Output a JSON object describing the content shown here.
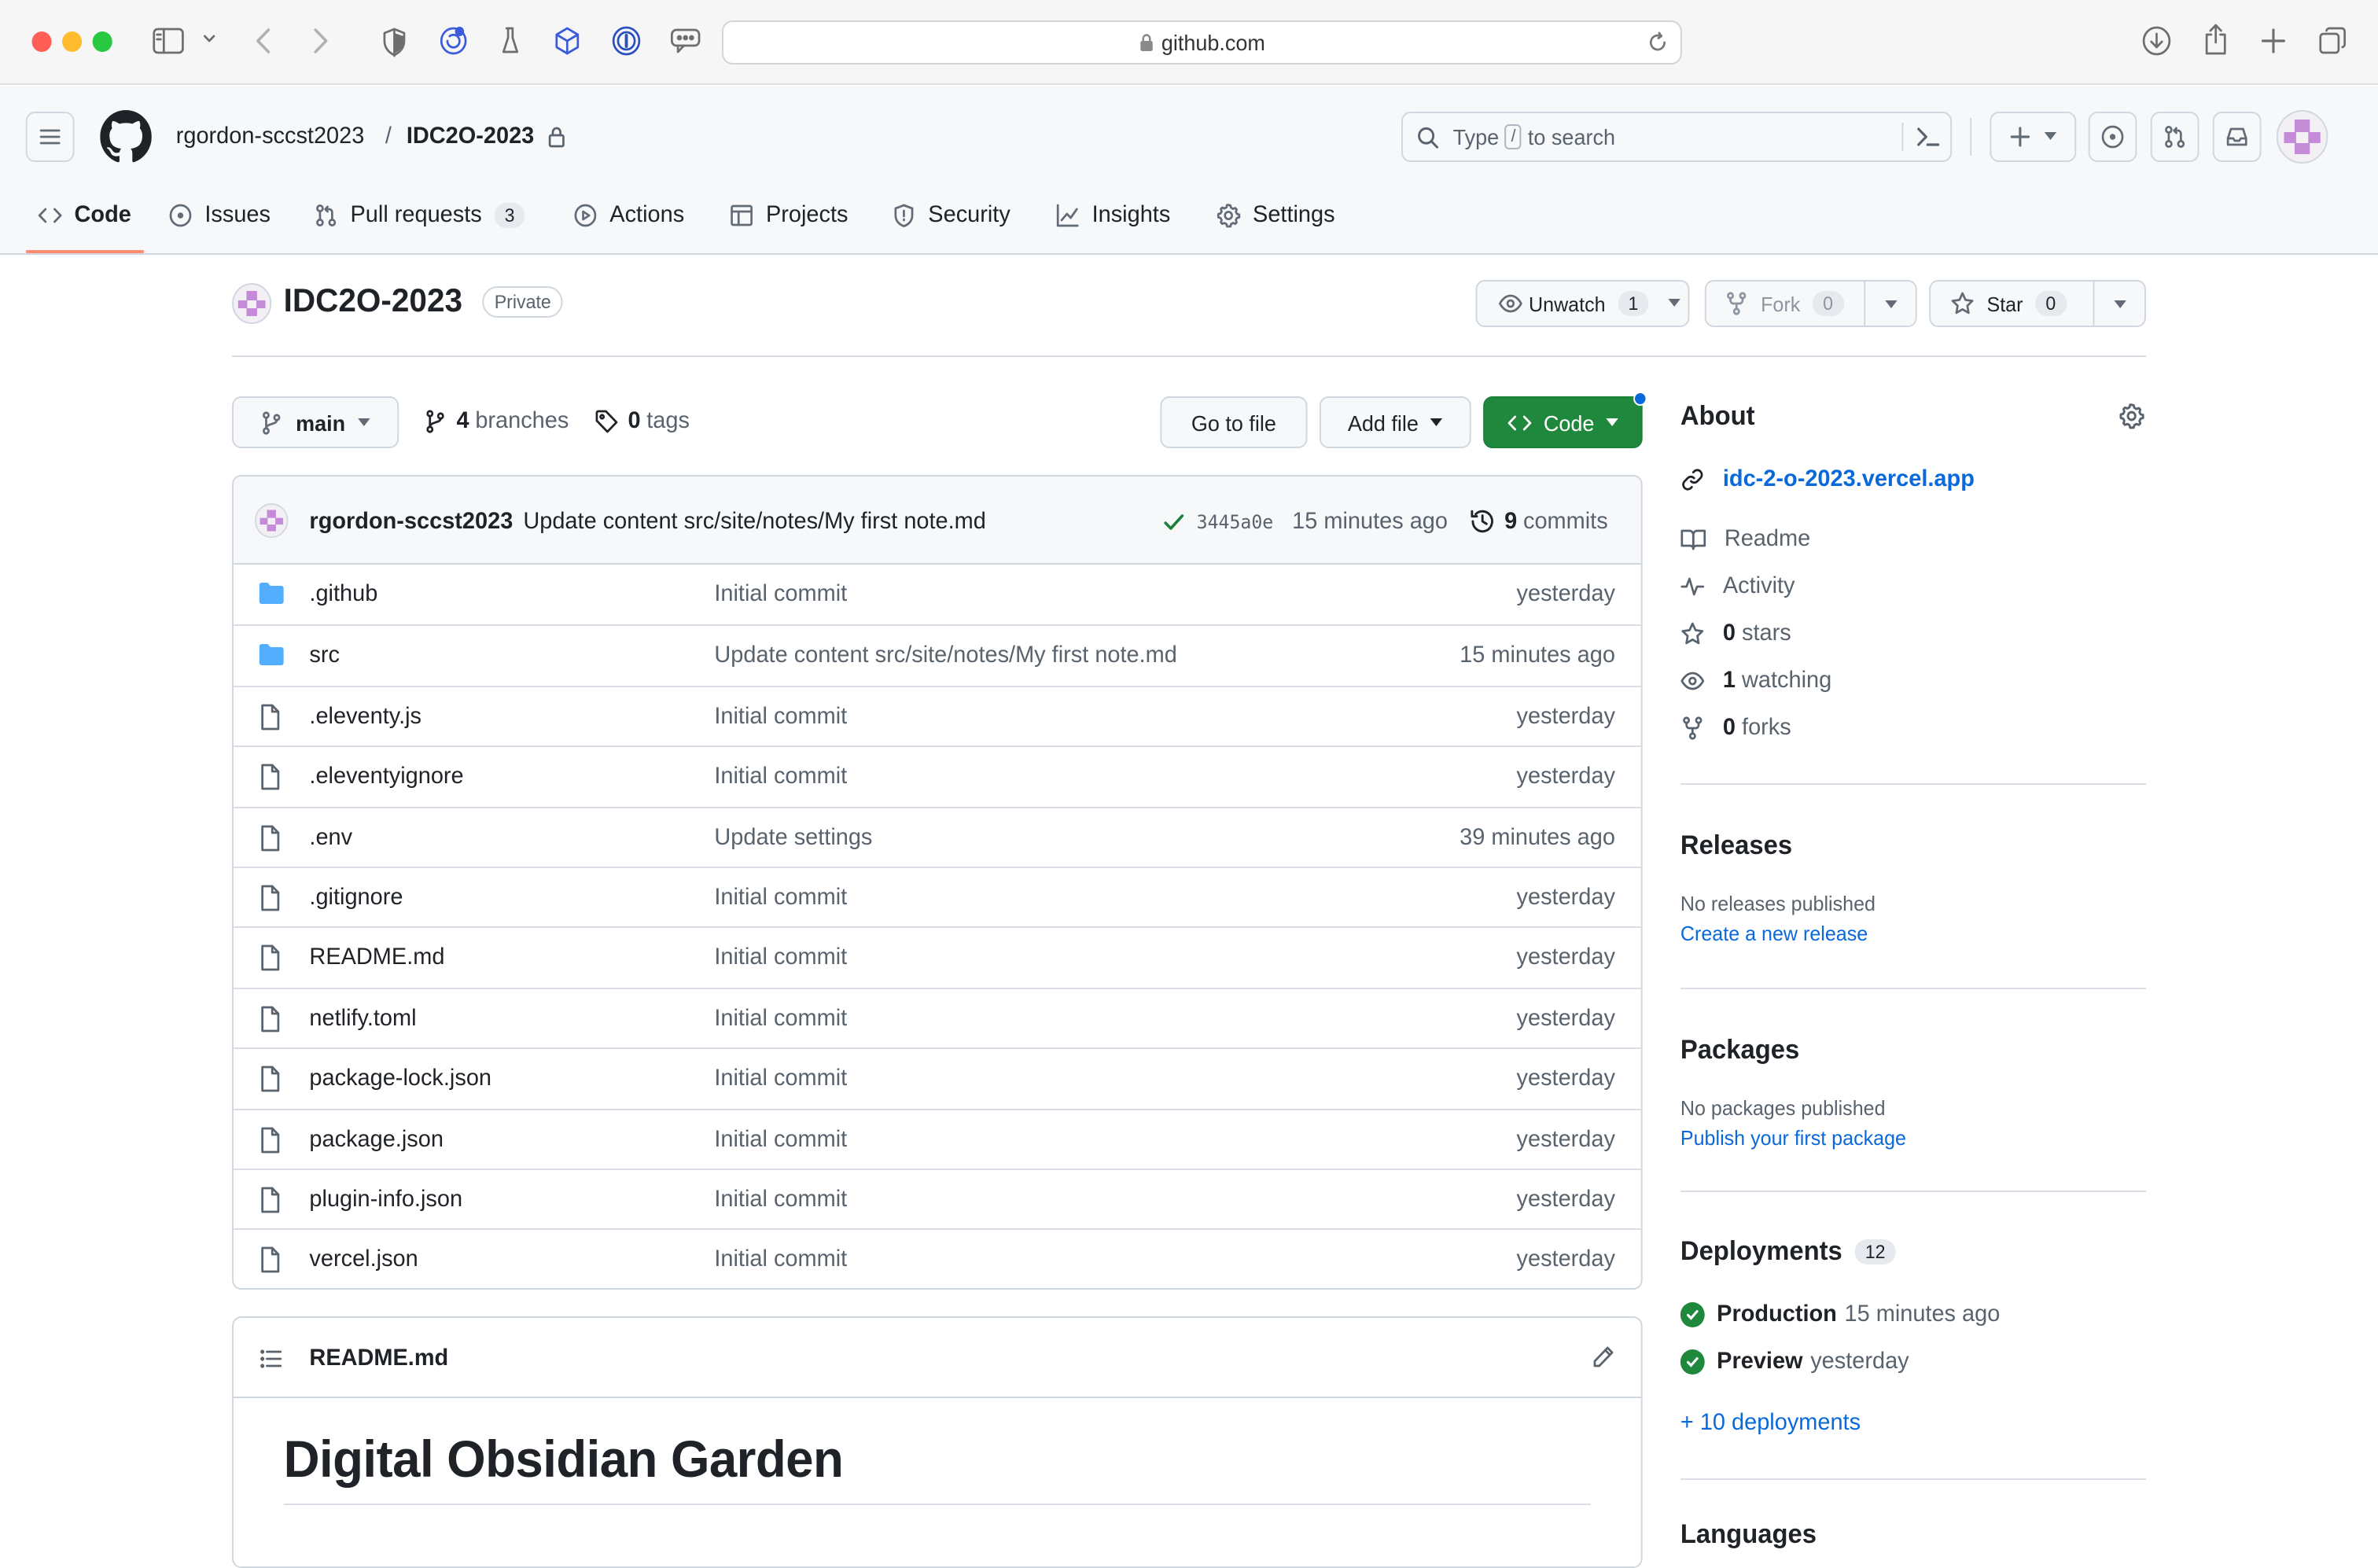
{
  "browser": {
    "url": "github.com"
  },
  "header": {
    "owner": "rgordon-sccst2023",
    "separator": "/",
    "repo": "IDC2O-2023",
    "search_prefix": "Type",
    "search_key": "/",
    "search_suffix": "to search"
  },
  "tabs": [
    {
      "label": "Code"
    },
    {
      "label": "Issues"
    },
    {
      "label": "Pull requests",
      "count": "3"
    },
    {
      "label": "Actions"
    },
    {
      "label": "Projects"
    },
    {
      "label": "Security"
    },
    {
      "label": "Insights"
    },
    {
      "label": "Settings"
    }
  ],
  "repo": {
    "name": "IDC2O-2023",
    "visibility": "Private",
    "unwatch_label": "Unwatch",
    "watch_count": "1",
    "fork_label": "Fork",
    "fork_count": "0",
    "star_label": "Star",
    "star_count": "0"
  },
  "toolbar": {
    "branch": "main",
    "branches_count": "4",
    "branches_label": "branches",
    "tags_count": "0",
    "tags_label": "tags",
    "go_to_file": "Go to file",
    "add_file": "Add file",
    "code": "Code"
  },
  "commit": {
    "author": "rgordon-sccst2023",
    "message": "Update content src/site/notes/My first note.md",
    "sha": "3445a0e",
    "age": "15 minutes ago",
    "commits_count": "9",
    "commits_label": "commits"
  },
  "files": [
    {
      "type": "folder",
      "name": ".github",
      "message": "Initial commit",
      "age": "yesterday"
    },
    {
      "type": "folder",
      "name": "src",
      "message": "Update content src/site/notes/My first note.md",
      "age": "15 minutes ago"
    },
    {
      "type": "file",
      "name": ".eleventy.js",
      "message": "Initial commit",
      "age": "yesterday"
    },
    {
      "type": "file",
      "name": ".eleventyignore",
      "message": "Initial commit",
      "age": "yesterday"
    },
    {
      "type": "file",
      "name": ".env",
      "message": "Update settings",
      "age": "39 minutes ago"
    },
    {
      "type": "file",
      "name": ".gitignore",
      "message": "Initial commit",
      "age": "yesterday"
    },
    {
      "type": "file",
      "name": "README.md",
      "message": "Initial commit",
      "age": "yesterday"
    },
    {
      "type": "file",
      "name": "netlify.toml",
      "message": "Initial commit",
      "age": "yesterday"
    },
    {
      "type": "file",
      "name": "package-lock.json",
      "message": "Initial commit",
      "age": "yesterday"
    },
    {
      "type": "file",
      "name": "package.json",
      "message": "Initial commit",
      "age": "yesterday"
    },
    {
      "type": "file",
      "name": "plugin-info.json",
      "message": "Initial commit",
      "age": "yesterday"
    },
    {
      "type": "file",
      "name": "vercel.json",
      "message": "Initial commit",
      "age": "yesterday"
    }
  ],
  "readme": {
    "filename": "README.md",
    "heading": "Digital Obsidian Garden"
  },
  "about": {
    "title": "About",
    "website": "idc-2-o-2023.vercel.app",
    "readme": "Readme",
    "activity": "Activity",
    "stars_count": "0",
    "stars_label": "stars",
    "watching_count": "1",
    "watching_label": "watching",
    "forks_count": "0",
    "forks_label": "forks"
  },
  "releases": {
    "title": "Releases",
    "empty": "No releases published",
    "link": "Create a new release"
  },
  "packages": {
    "title": "Packages",
    "empty": "No packages published",
    "link": "Publish your first package"
  },
  "deployments": {
    "title": "Deployments",
    "count": "12",
    "items": [
      {
        "env": "Production",
        "age": "15 minutes ago"
      },
      {
        "env": "Preview",
        "age": "yesterday"
      }
    ],
    "more": "+ 10 deployments"
  },
  "languages": {
    "title": "Languages"
  },
  "colors": {
    "accent": "#0969da",
    "green": "#1f883d",
    "tab_underline": "#fd8c73"
  }
}
